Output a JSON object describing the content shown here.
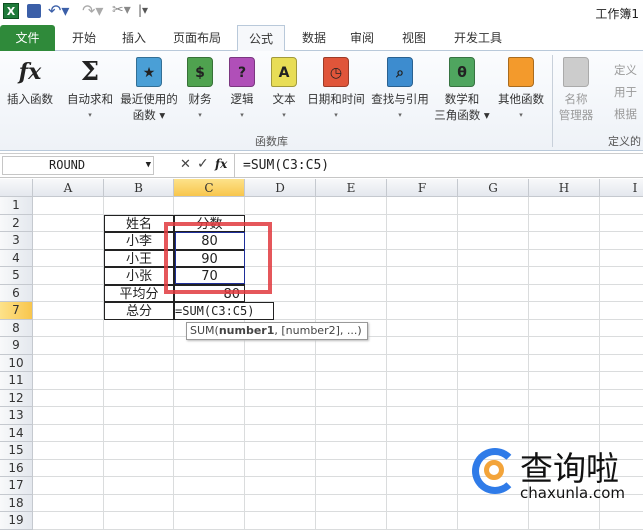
{
  "titlebar": {
    "title": "工作簿1",
    "qat": [
      "excel-logo-icon",
      "save-icon",
      "undo-icon",
      "redo-icon",
      "tools-icon",
      "customize-icon"
    ]
  },
  "tabs": [
    {
      "label": "文件"
    },
    {
      "label": "开始"
    },
    {
      "label": "插入"
    },
    {
      "label": "页面布局"
    },
    {
      "label": "公式",
      "active": true
    },
    {
      "label": "数据"
    },
    {
      "label": "审阅"
    },
    {
      "label": "视图"
    },
    {
      "label": "开发工具"
    }
  ],
  "ribbon": {
    "buttons": [
      {
        "label": "插入函数",
        "label2": "",
        "glyph": "fx",
        "color": "transparent"
      },
      {
        "label": "自动求和",
        "label2": "▾",
        "glyph": "Σ",
        "color": "transparent"
      },
      {
        "label": "最近使用的",
        "label2": "函数 ▾",
        "glyph": "★",
        "color": "#4a9fd6"
      },
      {
        "label": "财务",
        "label2": "▾",
        "glyph": "$",
        "color": "#4fa24f"
      },
      {
        "label": "逻辑",
        "label2": "▾",
        "glyph": "?",
        "color": "#b04fb8"
      },
      {
        "label": "文本",
        "label2": "▾",
        "glyph": "A",
        "color": "#e8dd56"
      },
      {
        "label": "日期和时间",
        "label2": "▾",
        "glyph": "◷",
        "color": "#e0553a"
      },
      {
        "label": "查找与引用",
        "label2": "▾",
        "glyph": "⌕",
        "color": "#3d8ccf"
      },
      {
        "label": "数学和",
        "label2": "三角函数 ▾",
        "glyph": "θ",
        "color": "#4fa55f"
      },
      {
        "label": "其他函数",
        "label2": "▾",
        "glyph": "",
        "color": "#f39a2c"
      }
    ],
    "group_label": "函数库",
    "name_manager": {
      "label": "名称",
      "label2": "管理器"
    },
    "defined": {
      "items": [
        "定义",
        "用于",
        "根据"
      ],
      "group_label": "定义的"
    }
  },
  "formula_bar": {
    "name_box": "ROUND",
    "cancel": "✕",
    "enter": "✓",
    "fx": "fx",
    "formula": "=SUM(C3:C5)"
  },
  "columns": [
    "A",
    "B",
    "C",
    "D",
    "E",
    "F",
    "G",
    "H",
    "I"
  ],
  "selected_column": "C",
  "rows": [
    "1",
    "2",
    "3",
    "4",
    "5",
    "6",
    "7",
    "8",
    "9",
    "10",
    "11",
    "12",
    "13",
    "14",
    "15",
    "16",
    "17",
    "18",
    "19"
  ],
  "selected_row": "7",
  "cells": {
    "B2": "姓名",
    "C2": "分数",
    "B3": "小李",
    "C3": "80",
    "B4": "小王",
    "C4": "90",
    "B5": "小张",
    "C5": "70",
    "B6": "平均分",
    "C6": "80",
    "B7": "总分",
    "C7": "=SUM(C3:C5)"
  },
  "tooltip": {
    "prefix": "SUM(",
    "bold": "number1",
    "rest": ", [number2], ...)"
  },
  "watermark": {
    "text": "查询啦",
    "url": "chaxunla.com"
  },
  "colors": {
    "file_tab": "#2f8a3a",
    "highlight_box": "#e0393e",
    "selection": "#1f2f9a"
  }
}
